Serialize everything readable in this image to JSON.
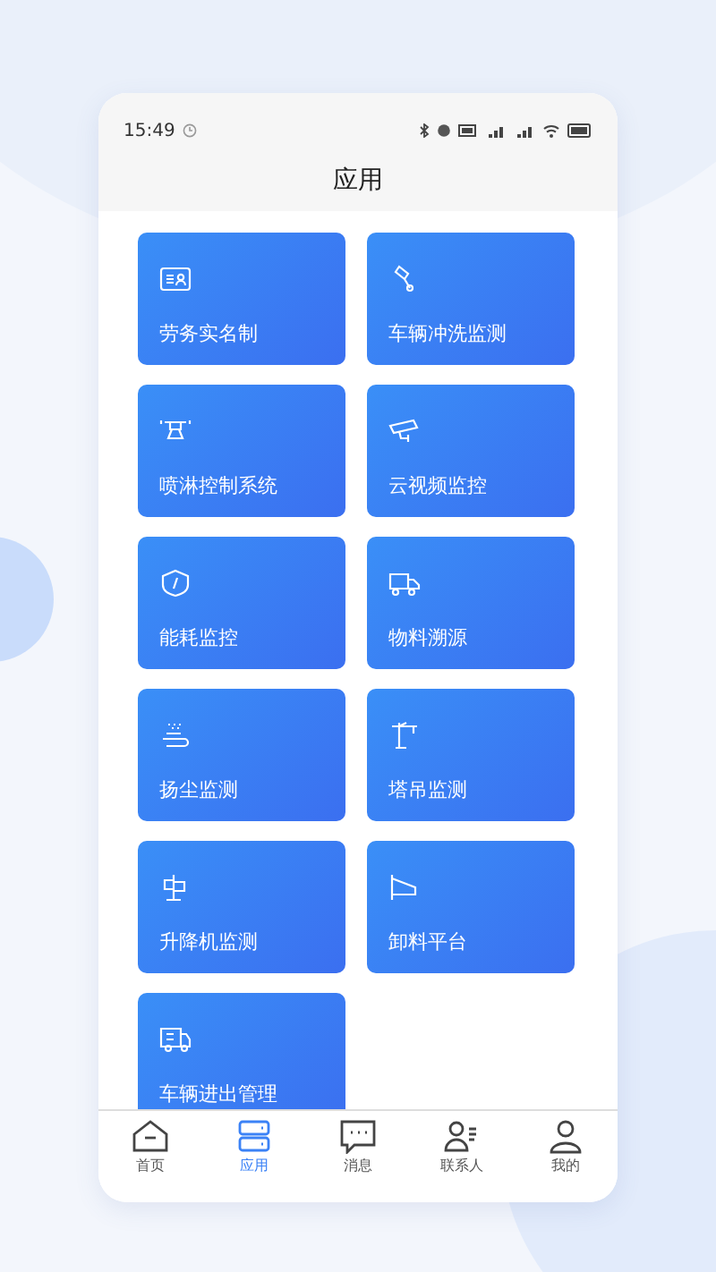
{
  "status_bar": {
    "time": "15:49"
  },
  "header": {
    "title": "应用"
  },
  "apps": [
    {
      "label": "劳务实名制"
    },
    {
      "label": "车辆冲洗监测"
    },
    {
      "label": "喷淋控制系统"
    },
    {
      "label": "云视频监控"
    },
    {
      "label": "能耗监控"
    },
    {
      "label": "物料溯源"
    },
    {
      "label": "扬尘监测"
    },
    {
      "label": "塔吊监测"
    },
    {
      "label": "升降机监测"
    },
    {
      "label": "卸料平台"
    },
    {
      "label": "车辆进出管理"
    }
  ],
  "tab_bar": [
    {
      "label": "首页",
      "selected": false
    },
    {
      "label": "应用",
      "selected": true
    },
    {
      "label": "消息",
      "selected": false
    },
    {
      "label": "联系人",
      "selected": false
    },
    {
      "label": "我的",
      "selected": false
    }
  ]
}
